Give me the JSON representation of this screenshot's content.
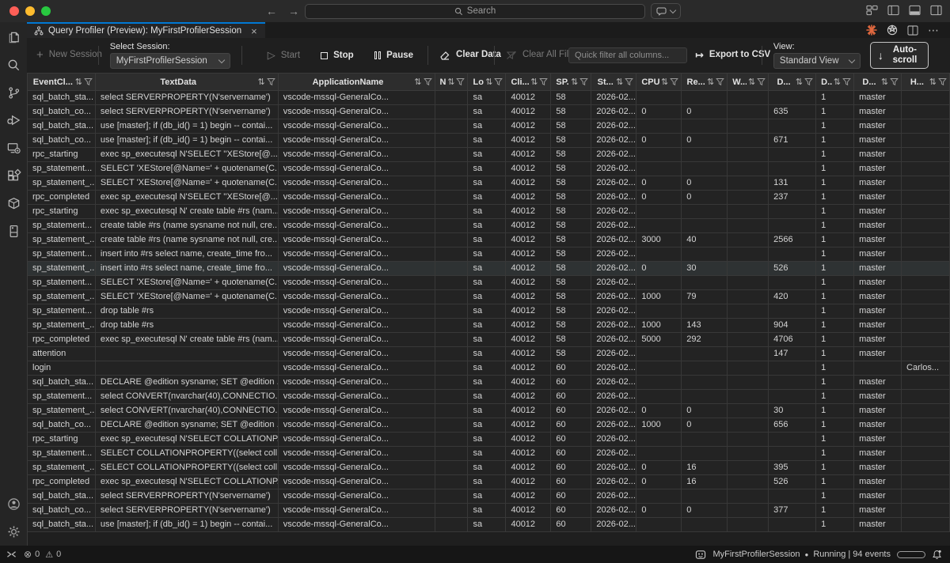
{
  "titlebar": {
    "search_placeholder": "Search"
  },
  "tab": {
    "title": "Query Profiler (Preview): MyFirstProfilerSession"
  },
  "toolbar": {
    "new_session": "New Session",
    "select_session_label": "Select Session:",
    "select_session_value": "MyFirstProfilerSession",
    "start": "Start",
    "stop": "Stop",
    "pause": "Pause",
    "clear_data": "Clear Data",
    "clear_all_filters": "Clear All Filters",
    "quick_filter_placeholder": "Quick filter all columns...",
    "export_csv": "Export to CSV",
    "view_label": "View:",
    "view_value": "Standard View",
    "autoscroll": "Auto-scroll"
  },
  "icons": {
    "sort": "⇅",
    "start": "▷",
    "export": "↦",
    "autoscroll_arrow": "↓",
    "plus": "+",
    "back": "←",
    "forward": "→",
    "ellipsis": "⋯",
    "close": "×",
    "error": "⊗",
    "warning": "⚠",
    "recording_dot": "●"
  },
  "table": {
    "columns": [
      "EventCl...",
      "TextData",
      "ApplicationName",
      "N...",
      "Lo...",
      "Cli...",
      "SP...",
      "St...",
      "CPU",
      "Re...",
      "W...",
      "D...",
      "D...",
      "D...",
      "H..."
    ],
    "highlighted_row_index": 12,
    "rows": [
      [
        "sql_batch_sta...",
        "select SERVERPROPERTY(N'servername')",
        "vscode-mssql-GeneralCo...",
        "",
        "sa",
        "40012",
        "58",
        "2026-02...",
        "",
        "",
        "",
        "",
        "1",
        "master",
        ""
      ],
      [
        "sql_batch_co...",
        "select SERVERPROPERTY(N'servername')",
        "vscode-mssql-GeneralCo...",
        "",
        "sa",
        "40012",
        "58",
        "2026-02...",
        "0",
        "0",
        "",
        "635",
        "1",
        "master",
        ""
      ],
      [
        "sql_batch_sta...",
        "use [master]; if (db_id() = 1) begin -- contai...",
        "vscode-mssql-GeneralCo...",
        "",
        "sa",
        "40012",
        "58",
        "2026-02...",
        "",
        "",
        "",
        "",
        "1",
        "master",
        ""
      ],
      [
        "sql_batch_co...",
        "use [master]; if (db_id() = 1) begin -- contai...",
        "vscode-mssql-GeneralCo...",
        "",
        "sa",
        "40012",
        "58",
        "2026-02...",
        "0",
        "0",
        "",
        "671",
        "1",
        "master",
        ""
      ],
      [
        "rpc_starting",
        "exec sp_executesql N'SELECT ''XEStore[@...",
        "vscode-mssql-GeneralCo...",
        "",
        "sa",
        "40012",
        "58",
        "2026-02...",
        "",
        "",
        "",
        "",
        "1",
        "master",
        ""
      ],
      [
        "sp_statement...",
        "SELECT 'XEStore[@Name=' + quotename(C...",
        "vscode-mssql-GeneralCo...",
        "",
        "sa",
        "40012",
        "58",
        "2026-02...",
        "",
        "",
        "",
        "",
        "1",
        "master",
        ""
      ],
      [
        "sp_statement_...",
        "SELECT 'XEStore[@Name=' + quotename(C...",
        "vscode-mssql-GeneralCo...",
        "",
        "sa",
        "40012",
        "58",
        "2026-02...",
        "0",
        "0",
        "",
        "131",
        "1",
        "master",
        ""
      ],
      [
        "rpc_completed",
        "exec sp_executesql N'SELECT ''XEStore[@...",
        "vscode-mssql-GeneralCo...",
        "",
        "sa",
        "40012",
        "58",
        "2026-02...",
        "0",
        "0",
        "",
        "237",
        "1",
        "master",
        ""
      ],
      [
        "rpc_starting",
        "exec sp_executesql N' create table #rs (nam...",
        "vscode-mssql-GeneralCo...",
        "",
        "sa",
        "40012",
        "58",
        "2026-02...",
        "",
        "",
        "",
        "",
        "1",
        "master",
        ""
      ],
      [
        "sp_statement...",
        "create table #rs (name sysname not null, cre...",
        "vscode-mssql-GeneralCo...",
        "",
        "sa",
        "40012",
        "58",
        "2026-02...",
        "",
        "",
        "",
        "",
        "1",
        "master",
        ""
      ],
      [
        "sp_statement_...",
        "create table #rs (name sysname not null, cre...",
        "vscode-mssql-GeneralCo...",
        "",
        "sa",
        "40012",
        "58",
        "2026-02...",
        "3000",
        "40",
        "",
        "2566",
        "1",
        "master",
        ""
      ],
      [
        "sp_statement...",
        "insert into #rs select name, create_time fro...",
        "vscode-mssql-GeneralCo...",
        "",
        "sa",
        "40012",
        "58",
        "2026-02...",
        "",
        "",
        "",
        "",
        "1",
        "master",
        ""
      ],
      [
        "sp_statement_...",
        "insert into #rs select name, create_time fro...",
        "vscode-mssql-GeneralCo...",
        "",
        "sa",
        "40012",
        "58",
        "2026-02...",
        "0",
        "30",
        "",
        "526",
        "1",
        "master",
        ""
      ],
      [
        "sp_statement...",
        "SELECT 'XEStore[@Name=' + quotename(C...",
        "vscode-mssql-GeneralCo...",
        "",
        "sa",
        "40012",
        "58",
        "2026-02...",
        "",
        "",
        "",
        "",
        "1",
        "master",
        ""
      ],
      [
        "sp_statement_...",
        "SELECT 'XEStore[@Name=' + quotename(C...",
        "vscode-mssql-GeneralCo...",
        "",
        "sa",
        "40012",
        "58",
        "2026-02...",
        "1000",
        "79",
        "",
        "420",
        "1",
        "master",
        ""
      ],
      [
        "sp_statement...",
        "drop table #rs",
        "vscode-mssql-GeneralCo...",
        "",
        "sa",
        "40012",
        "58",
        "2026-02...",
        "",
        "",
        "",
        "",
        "1",
        "master",
        ""
      ],
      [
        "sp_statement_...",
        "drop table #rs",
        "vscode-mssql-GeneralCo...",
        "",
        "sa",
        "40012",
        "58",
        "2026-02...",
        "1000",
        "143",
        "",
        "904",
        "1",
        "master",
        ""
      ],
      [
        "rpc_completed",
        "exec sp_executesql N' create table #rs (nam...",
        "vscode-mssql-GeneralCo...",
        "",
        "sa",
        "40012",
        "58",
        "2026-02...",
        "5000",
        "292",
        "",
        "4706",
        "1",
        "master",
        ""
      ],
      [
        "attention",
        "",
        "vscode-mssql-GeneralCo...",
        "",
        "sa",
        "40012",
        "58",
        "2026-02...",
        "",
        "",
        "",
        "147",
        "1",
        "master",
        ""
      ],
      [
        "login",
        "",
        "vscode-mssql-GeneralCo...",
        "",
        "sa",
        "40012",
        "60",
        "2026-02...",
        "",
        "",
        "",
        "",
        "1",
        "",
        "Carlos..."
      ],
      [
        "sql_batch_sta...",
        "DECLARE @edition sysname; SET @edition ...",
        "vscode-mssql-GeneralCo...",
        "",
        "sa",
        "40012",
        "60",
        "2026-02...",
        "",
        "",
        "",
        "",
        "1",
        "master",
        ""
      ],
      [
        "sp_statement...",
        "select CONVERT(nvarchar(40),CONNECTIO...",
        "vscode-mssql-GeneralCo...",
        "",
        "sa",
        "40012",
        "60",
        "2026-02...",
        "",
        "",
        "",
        "",
        "1",
        "master",
        ""
      ],
      [
        "sp_statement_...",
        "select CONVERT(nvarchar(40),CONNECTIO...",
        "vscode-mssql-GeneralCo...",
        "",
        "sa",
        "40012",
        "60",
        "2026-02...",
        "0",
        "0",
        "",
        "30",
        "1",
        "master",
        ""
      ],
      [
        "sql_batch_co...",
        "DECLARE @edition sysname; SET @edition ...",
        "vscode-mssql-GeneralCo...",
        "",
        "sa",
        "40012",
        "60",
        "2026-02...",
        "1000",
        "0",
        "",
        "656",
        "1",
        "master",
        ""
      ],
      [
        "rpc_starting",
        "exec sp_executesql N'SELECT COLLATIONP...",
        "vscode-mssql-GeneralCo...",
        "",
        "sa",
        "40012",
        "60",
        "2026-02...",
        "",
        "",
        "",
        "",
        "1",
        "master",
        ""
      ],
      [
        "sp_statement...",
        "SELECT COLLATIONPROPERTY((select coll...",
        "vscode-mssql-GeneralCo...",
        "",
        "sa",
        "40012",
        "60",
        "2026-02...",
        "",
        "",
        "",
        "",
        "1",
        "master",
        ""
      ],
      [
        "sp_statement_...",
        "SELECT COLLATIONPROPERTY((select coll...",
        "vscode-mssql-GeneralCo...",
        "",
        "sa",
        "40012",
        "60",
        "2026-02...",
        "0",
        "16",
        "",
        "395",
        "1",
        "master",
        ""
      ],
      [
        "rpc_completed",
        "exec sp_executesql N'SELECT COLLATIONP...",
        "vscode-mssql-GeneralCo...",
        "",
        "sa",
        "40012",
        "60",
        "2026-02...",
        "0",
        "16",
        "",
        "526",
        "1",
        "master",
        ""
      ],
      [
        "sql_batch_sta...",
        "select SERVERPROPERTY(N'servername')",
        "vscode-mssql-GeneralCo...",
        "",
        "sa",
        "40012",
        "60",
        "2026-02...",
        "",
        "",
        "",
        "",
        "1",
        "master",
        ""
      ],
      [
        "sql_batch_co...",
        "select SERVERPROPERTY(N'servername')",
        "vscode-mssql-GeneralCo...",
        "",
        "sa",
        "40012",
        "60",
        "2026-02...",
        "0",
        "0",
        "",
        "377",
        "1",
        "master",
        ""
      ],
      [
        "sql_batch_sta...",
        "use [master]; if (db_id() = 1) begin -- contai...",
        "vscode-mssql-GeneralCo...",
        "",
        "sa",
        "40012",
        "60",
        "2026-02...",
        "",
        "",
        "",
        "",
        "1",
        "master",
        ""
      ]
    ]
  },
  "statusbar": {
    "errors": "0",
    "warnings": "0",
    "session": "MyFirstProfilerSession",
    "state": "Running | 94 events"
  },
  "colors": {
    "accent_blue": "#0078d4",
    "traffic_red": "#ff5f57",
    "traffic_yellow": "#febc2e",
    "traffic_green": "#28c840",
    "starburst_orange": "#e0683f"
  }
}
